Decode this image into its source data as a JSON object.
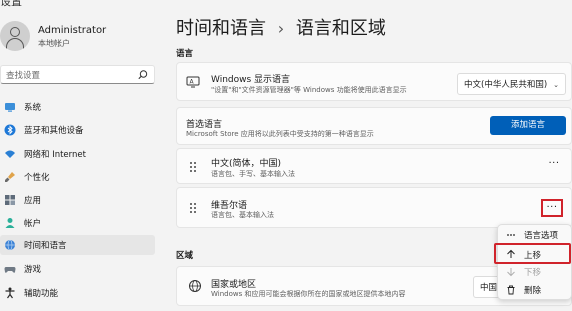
{
  "window": {
    "title": "设置"
  },
  "user": {
    "name": "Administrator",
    "account_type": "本地帐户"
  },
  "search": {
    "placeholder": "查找设置"
  },
  "sidebar": {
    "items": [
      {
        "label": "系统",
        "icon": "monitor-icon"
      },
      {
        "label": "蓝牙和其他设备",
        "icon": "bluetooth-icon"
      },
      {
        "label": "网络和 Internet",
        "icon": "wifi-icon"
      },
      {
        "label": "个性化",
        "icon": "brush-icon"
      },
      {
        "label": "应用",
        "icon": "apps-icon"
      },
      {
        "label": "帐户",
        "icon": "person-icon"
      },
      {
        "label": "时间和语言",
        "icon": "globe-clock-icon",
        "active": true
      },
      {
        "label": "游戏",
        "icon": "gamepad-icon"
      },
      {
        "label": "辅助功能",
        "icon": "accessibility-icon"
      }
    ]
  },
  "header": {
    "breadcrumb_parent": "时间和语言",
    "separator": "›",
    "title": "语言和区域"
  },
  "language_section": {
    "label": "语言",
    "display_language": {
      "title": "Windows 显示语言",
      "subtitle": "\"设置\"和\"文件资源管理器\"等 Windows 功能将使用此语言显示",
      "selected": "中文(中华人民共和国)"
    },
    "preferred": {
      "title": "首选语言",
      "subtitle": "Microsoft Store 应用将以此列表中受支持的第一种语言显示",
      "add_button": "添加语言"
    },
    "languages": [
      {
        "name": "中文(简体，中国)",
        "features": "语言包、手写、基本输入法"
      },
      {
        "name": "维吾尔语",
        "features": "语言包、基本输入法"
      }
    ],
    "more_label": "···"
  },
  "region_section": {
    "label": "区域",
    "country": {
      "title": "国家或地区",
      "subtitle": "Windows 和应用可能会根据你所在的国家或地区提供本地内容",
      "selected_partial": "中国"
    }
  },
  "context_menu": {
    "items": [
      {
        "label": "语言选项",
        "icon": "more-icon",
        "enabled": true
      },
      {
        "label": "上移",
        "icon": "arrow-up-icon",
        "enabled": true
      },
      {
        "label": "下移",
        "icon": "arrow-down-icon",
        "enabled": false
      },
      {
        "label": "删除",
        "icon": "trash-icon",
        "enabled": true
      }
    ]
  },
  "colors": {
    "accent": "#005fb8",
    "highlight": "#d0232b"
  }
}
